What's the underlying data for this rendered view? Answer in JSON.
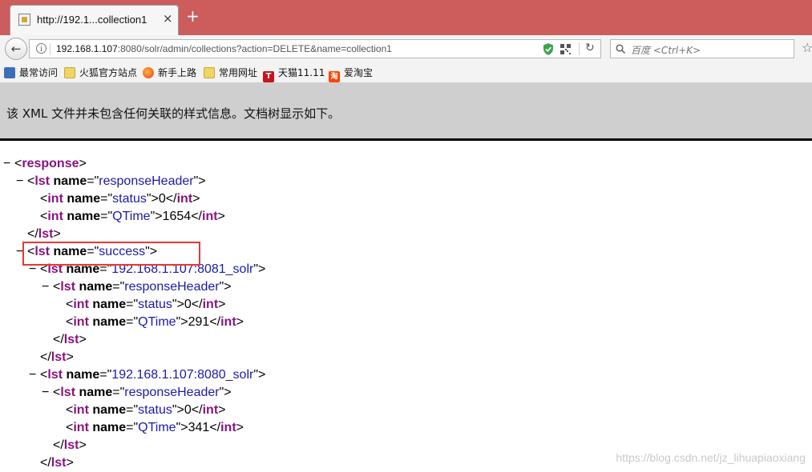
{
  "tab": {
    "title": "http://192.1...collection1",
    "close": "×"
  },
  "new_tab": "+",
  "navbar": {
    "url_host": "192.168.1.107",
    "url_rest": ":8080/solr/admin/collections?action=DELETE&name=collection1",
    "search_placeholder": "百度 <Ctrl+K>"
  },
  "bookmarks": [
    {
      "label": "最常访问",
      "icon": "most-visited-icon"
    },
    {
      "label": "火狐官方站点",
      "icon": "folder-icon"
    },
    {
      "label": "新手上路",
      "icon": "firefox-icon"
    },
    {
      "label": "常用网址",
      "icon": "folder-icon"
    },
    {
      "label": "天猫11.11",
      "icon": "tmall-icon",
      "glyph": "T"
    },
    {
      "label": "爱淘宝",
      "icon": "taobao-icon",
      "glyph": "淘"
    }
  ],
  "banner": {
    "text": "该 XML 文件并未包含任何关联的样式信息。文档树显示如下。"
  },
  "xml": {
    "response_tag": "response",
    "lst_tag": "lst",
    "int_tag": "int",
    "attr": "name",
    "header_name": "responseHeader",
    "status_name": "status",
    "qtime_name": "QTime",
    "root_status": "0",
    "root_qtime": "1654",
    "success_name": "success",
    "node1_name": "192.168.1.107:8081_solr",
    "node1_status": "0",
    "node1_qtime": "291",
    "node2_name": "192.168.1.107:8080_solr",
    "node2_status": "0",
    "node2_qtime": "341"
  },
  "watermark": "https://blog.csdn.net/jz_lihuapiaoxiang",
  "colors": {
    "titlebar": "#cd5c5c",
    "tag": "#881280",
    "value": "#1a1aa6",
    "highlight": "#e53935"
  }
}
